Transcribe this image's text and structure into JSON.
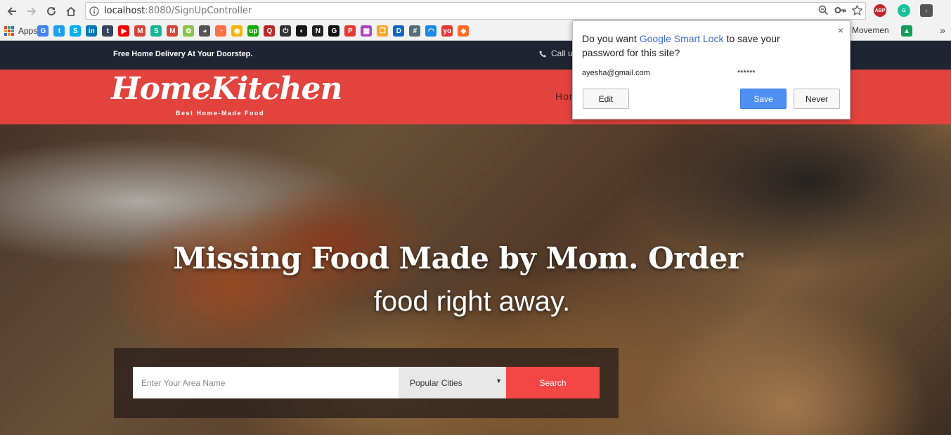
{
  "browser": {
    "url_host": "localhost",
    "url_rest": ":8080/SignUpController",
    "bookmarks": {
      "apps_label": "Apps",
      "movement_label": "Movemen"
    },
    "overflow_label": "»"
  },
  "site": {
    "promo_text": "Free Home Delivery At Your Doorstep.",
    "call_text": "Call us",
    "logo_main": "HomeKitchen",
    "logo_sub": "Best Home-Made Food",
    "nav_home": "Hom",
    "hero_line1": "Missing Food Made by Mom. Order",
    "hero_line2": "food right away.",
    "search": {
      "area_placeholder": "Enter Your Area Name",
      "city_selected": "Popular Cities",
      "search_label": "Search"
    }
  },
  "popup": {
    "msg_prefix": "Do you want ",
    "msg_link": "Google Smart Lock",
    "msg_suffix": " to save your password for this site?",
    "username": "ayesha@gmail.com",
    "password_mask": "******",
    "edit_label": "Edit",
    "save_label": "Save",
    "never_label": "Never",
    "close_glyph": "×"
  },
  "colors": {
    "header_red": "#e2433d",
    "topbar_navy": "#1f2433",
    "search_red": "#f54646",
    "save_blue": "#4e8ff3",
    "smart_lock_link": "#3c6fd1"
  },
  "icons": [
    "back-icon",
    "forward-icon",
    "reload-icon",
    "home-icon",
    "info-icon",
    "zoom-icon",
    "key-icon",
    "star-icon",
    "adblock-icon",
    "grammarly-icon",
    "download-icon",
    "apps-grid-icon",
    "phone-icon",
    "caret-down-icon",
    "close-icon"
  ]
}
